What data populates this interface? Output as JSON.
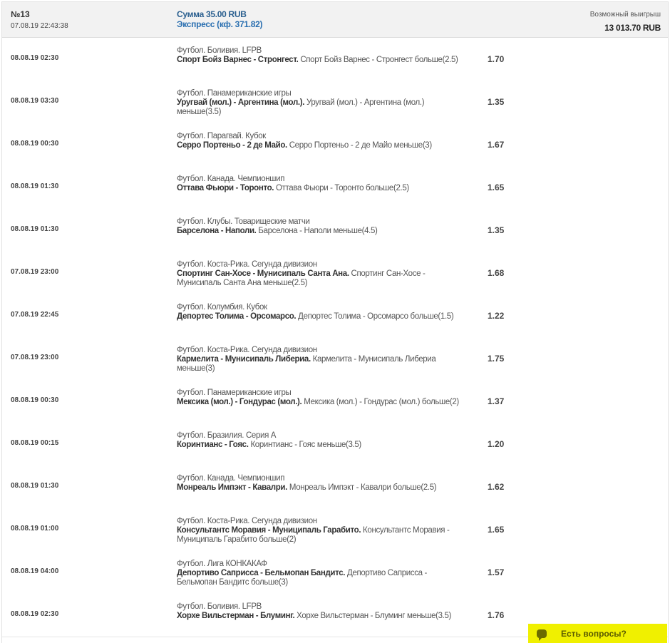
{
  "header": {
    "number": "№13",
    "datetime": "07.08.19 22:43:38",
    "sum": "Сумма 35.00 RUB",
    "express": "Экспресс (кф. 371.82)",
    "win_label": "Возможный выигрыш",
    "win_value": "13 013.70 RUB"
  },
  "rows": [
    {
      "date": "08.08.19 02:30",
      "league": "Футбол. Боливия. LFPB",
      "match": "Спорт Бойз Варнес - Стронгест.",
      "bet": "Спорт Бойз Варнес - Стронгест больше(2.5)",
      "odd": "1.70"
    },
    {
      "date": "08.08.19 03:30",
      "league": "Футбол. Панамериканские игры",
      "match": "Уругвай (мол.) - Аргентина (мол.).",
      "bet": "Уругвай (мол.) - Аргентина (мол.) меньше(3.5)",
      "odd": "1.35"
    },
    {
      "date": "08.08.19 00:30",
      "league": "Футбол. Парагвай. Кубок",
      "match": "Серро Портеньо - 2 де Майо.",
      "bet": "Серро Портеньо - 2 де Майо меньше(3)",
      "odd": "1.67"
    },
    {
      "date": "08.08.19 01:30",
      "league": "Футбол. Канада. Чемпионшип",
      "match": "Оттава Фьюри - Торонто.",
      "bet": "Оттава Фьюри - Торонто больше(2.5)",
      "odd": "1.65"
    },
    {
      "date": "08.08.19 01:30",
      "league": "Футбол. Клубы. Товарищеские матчи",
      "match": "Барселона - Наполи.",
      "bet": "Барселона - Наполи меньше(4.5)",
      "odd": "1.35"
    },
    {
      "date": "07.08.19 23:00",
      "league": "Футбол. Коста-Рика. Сегунда дивизион",
      "match": "Спортинг Сан-Хосе - Мунисипаль Санта Ана.",
      "bet": "Спортинг Сан-Хосе - Мунисипаль Санта Ана меньше(2.5)",
      "odd": "1.68"
    },
    {
      "date": "07.08.19 22:45",
      "league": "Футбол. Колумбия. Кубок",
      "match": "Депортес Толима - Орсомарсо.",
      "bet": "Депортес Толима - Орсомарсо больше(1.5)",
      "odd": "1.22"
    },
    {
      "date": "07.08.19 23:00",
      "league": "Футбол. Коста-Рика. Сегунда дивизион",
      "match": "Кармелита - Мунисипаль Либериа.",
      "bet": "Кармелита - Мунисипаль Либериа меньше(3)",
      "odd": "1.75"
    },
    {
      "date": "08.08.19 00:30",
      "league": "Футбол. Панамериканские игры",
      "match": "Мексика (мол.) - Гондурас (мол.).",
      "bet": "Мексика (мол.) - Гондурас (мол.) больше(2)",
      "odd": "1.37"
    },
    {
      "date": "08.08.19 00:15",
      "league": "Футбол. Бразилия. Серия А",
      "match": "Коринтианс - Гояс.",
      "bet": "Коринтианс - Гояс меньше(3.5)",
      "odd": "1.20"
    },
    {
      "date": "08.08.19 01:30",
      "league": "Футбол. Канада. Чемпионшип",
      "match": "Монреаль Импэкт - Кавалри.",
      "bet": "Монреаль Импэкт - Кавалри больше(2.5)",
      "odd": "1.62"
    },
    {
      "date": "08.08.19 01:00",
      "league": "Футбол. Коста-Рика. Сегунда дивизион",
      "match": "Консультантс Моравия - Муниципаль Гарабито.",
      "bet": "Консультантс Моравия - Муниципаль Гарабито больше(2)",
      "odd": "1.65"
    },
    {
      "date": "08.08.19 04:00",
      "league": "Футбол. Лига КОНКАКАФ",
      "match": "Депортиво Саприсса - Бельмопан Бандитс.",
      "bet": "Депортиво Саприсса - Бельмопан Бандитс больше(3)",
      "odd": "1.57"
    },
    {
      "date": "08.08.19 02:30",
      "league": "Футбол. Боливия. LFPB",
      "match": "Хорхе Вильстерман - Блуминг.",
      "bet": "Хорхе Вильстерман - Блуминг меньше(3.5)",
      "odd": "1.76"
    }
  ],
  "chat": {
    "label": "Есть вопросы?",
    "icon": "chat-bubble-icon",
    "color": "#f0f000"
  }
}
